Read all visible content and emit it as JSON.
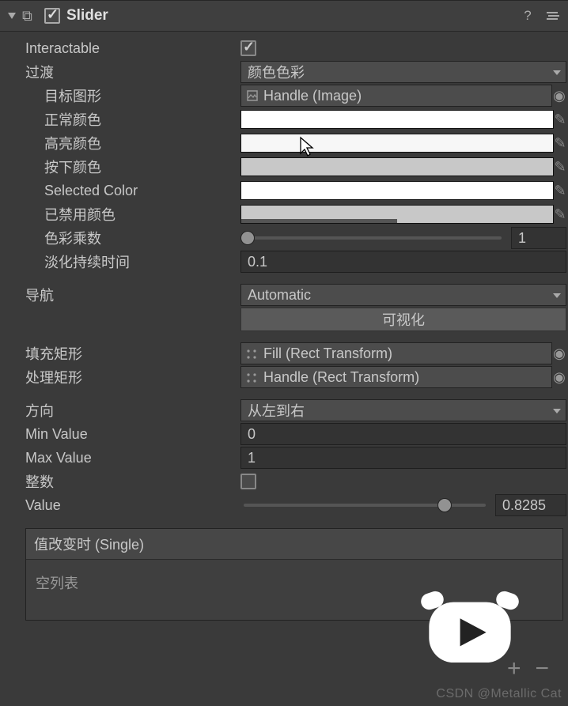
{
  "header": {
    "title": "Slider",
    "enabled": true
  },
  "fields": {
    "interactable": {
      "label": "Interactable",
      "checked": true
    },
    "transition": {
      "label": "过渡",
      "value": "颜色色彩"
    },
    "targetGraphic": {
      "label": "目标图形",
      "value": "Handle (Image)"
    },
    "normalColor": {
      "label": "正常颜色",
      "color": "#ffffff"
    },
    "highlightColor": {
      "label": "高亮颜色",
      "color": "#f7f7f7"
    },
    "pressedColor": {
      "label": "按下颜色",
      "color": "#c8c8c8"
    },
    "selectedColor": {
      "label": "Selected Color",
      "color": "#ffffff"
    },
    "disabledColor": {
      "label": "已禁用颜色",
      "color": "#c8c8c8"
    },
    "colorMultiplier": {
      "label": "色彩乘数",
      "value": "1",
      "slider": 0
    },
    "fadeDuration": {
      "label": "淡化持续时间",
      "value": "0.1"
    },
    "navigation": {
      "label": "导航",
      "value": "Automatic",
      "visualize": "可视化"
    },
    "fillRect": {
      "label": "填充矩形",
      "value": "Fill (Rect Transform)"
    },
    "handleRect": {
      "label": "处理矩形",
      "value": "Handle (Rect Transform)"
    },
    "direction": {
      "label": "方向",
      "value": "从左到右"
    },
    "minValue": {
      "label": "Min Value",
      "value": "0"
    },
    "maxValue": {
      "label": "Max Value",
      "value": "1"
    },
    "wholeNumbers": {
      "label": "整数",
      "checked": false
    },
    "value": {
      "label": "Value",
      "value": "0.8285",
      "slider": 0.8285
    }
  },
  "event": {
    "title": "值改变时 (Single)",
    "empty": "空列表"
  },
  "watermark": "CSDN @Metallic Cat"
}
